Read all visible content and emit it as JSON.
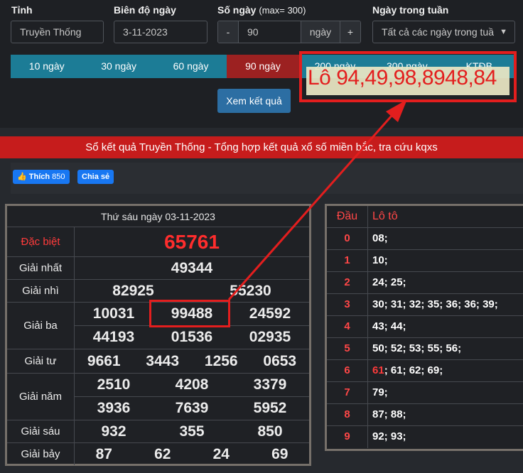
{
  "form": {
    "province_label": "Tỉnh",
    "province_value": "Truyền Thống",
    "date_label": "Biên độ ngày",
    "date_value": "3-11-2023",
    "days_label": "Số ngày",
    "days_hint": "(max= 300)",
    "days_minus": "-",
    "days_value": "90",
    "days_unit": "ngày",
    "days_plus": "+",
    "weekday_label": "Ngày trong tuần",
    "weekday_value": "Tất cả các ngày trong tuầ",
    "range_tabs": [
      "10 ngày",
      "30 ngày",
      "60 ngày",
      "90 ngày",
      "200 ngày",
      "300 ngày",
      "KTĐB"
    ],
    "active_tab": "90 ngày",
    "submit_label": "Xem kết quả"
  },
  "annotation": {
    "text": "Lô 94,49,98,8948,84",
    "color": "#e31e1e"
  },
  "banner": "Sổ kết quả Truyền Thống - Tổng hợp kết quả xổ số miền bắc, tra cứu kqxs",
  "social": {
    "like_label": "Thích",
    "like_count": "850",
    "share_label": "Chia sẻ"
  },
  "results": {
    "heading": "Thứ sáu ngày 03-11-2023",
    "prizes": [
      {
        "name": "Đặc biệt",
        "highlight": true,
        "lines": [
          [
            "65761"
          ]
        ]
      },
      {
        "name": "Giải nhất",
        "lines": [
          [
            "49344"
          ]
        ]
      },
      {
        "name": "Giải nhì",
        "lines": [
          [
            "82925",
            "55230"
          ]
        ]
      },
      {
        "name": "Giải ba",
        "lines": [
          [
            "10031",
            "99488",
            "24592"
          ],
          [
            "44193",
            "01536",
            "02935"
          ]
        ]
      },
      {
        "name": "Giải tư",
        "lines": [
          [
            "9661",
            "3443",
            "1256",
            "0653"
          ]
        ]
      },
      {
        "name": "Giải năm",
        "lines": [
          [
            "2510",
            "4208",
            "3379"
          ],
          [
            "3936",
            "7639",
            "5952"
          ]
        ]
      },
      {
        "name": "Giải sáu",
        "lines": [
          [
            "932",
            "355",
            "850"
          ]
        ]
      },
      {
        "name": "Giải bảy",
        "lines": [
          [
            "87",
            "62",
            "24",
            "69"
          ]
        ]
      }
    ]
  },
  "loto": {
    "head_label": "Đầu",
    "loto_label": "Lô tô",
    "rows": [
      {
        "d": "0",
        "v": "08;"
      },
      {
        "d": "1",
        "v": "10;"
      },
      {
        "d": "2",
        "v": "24; 25;"
      },
      {
        "d": "3",
        "v": "30; 31; 32; 35; 36; 36; 39;"
      },
      {
        "d": "4",
        "v": "43; 44;"
      },
      {
        "d": "5",
        "v": "50; 52; 53; 55; 56;"
      },
      {
        "d": "6",
        "hl": "61",
        "v": "; 61; 62; 69;"
      },
      {
        "d": "7",
        "v": "79;"
      },
      {
        "d": "8",
        "v": "87; 88;"
      },
      {
        "d": "9",
        "v": "92; 93;"
      }
    ]
  },
  "colors": {
    "accent_red": "#c61c1c",
    "tab_teal": "#1c7c96",
    "tab_active": "#9c2121",
    "button_blue": "#2c6ea3"
  }
}
